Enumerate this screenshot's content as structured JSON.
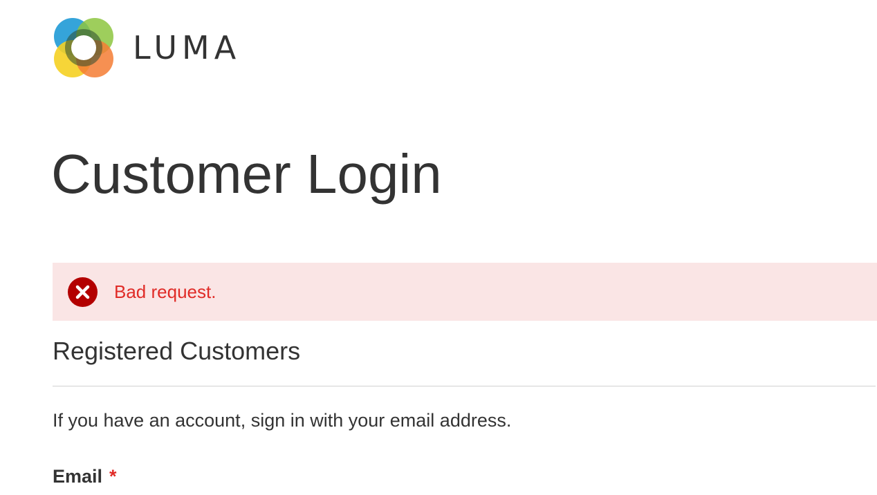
{
  "header": {
    "logo_text": "LUMA",
    "logo_colors": [
      "#1979c3",
      "#8dc63f",
      "#f3c623",
      "#f47c34"
    ]
  },
  "page": {
    "title": "Customer Login"
  },
  "message": {
    "type": "error",
    "icon": "error-circle-x-icon",
    "text": "Bad request.",
    "background_color": "#fae5e5",
    "text_color": "#e02b27",
    "icon_color": "#b30000"
  },
  "login_block": {
    "title": "Registered Customers",
    "intro": "If you have an account, sign in with your email address.",
    "email_label": "Email",
    "required_marker": "*"
  }
}
